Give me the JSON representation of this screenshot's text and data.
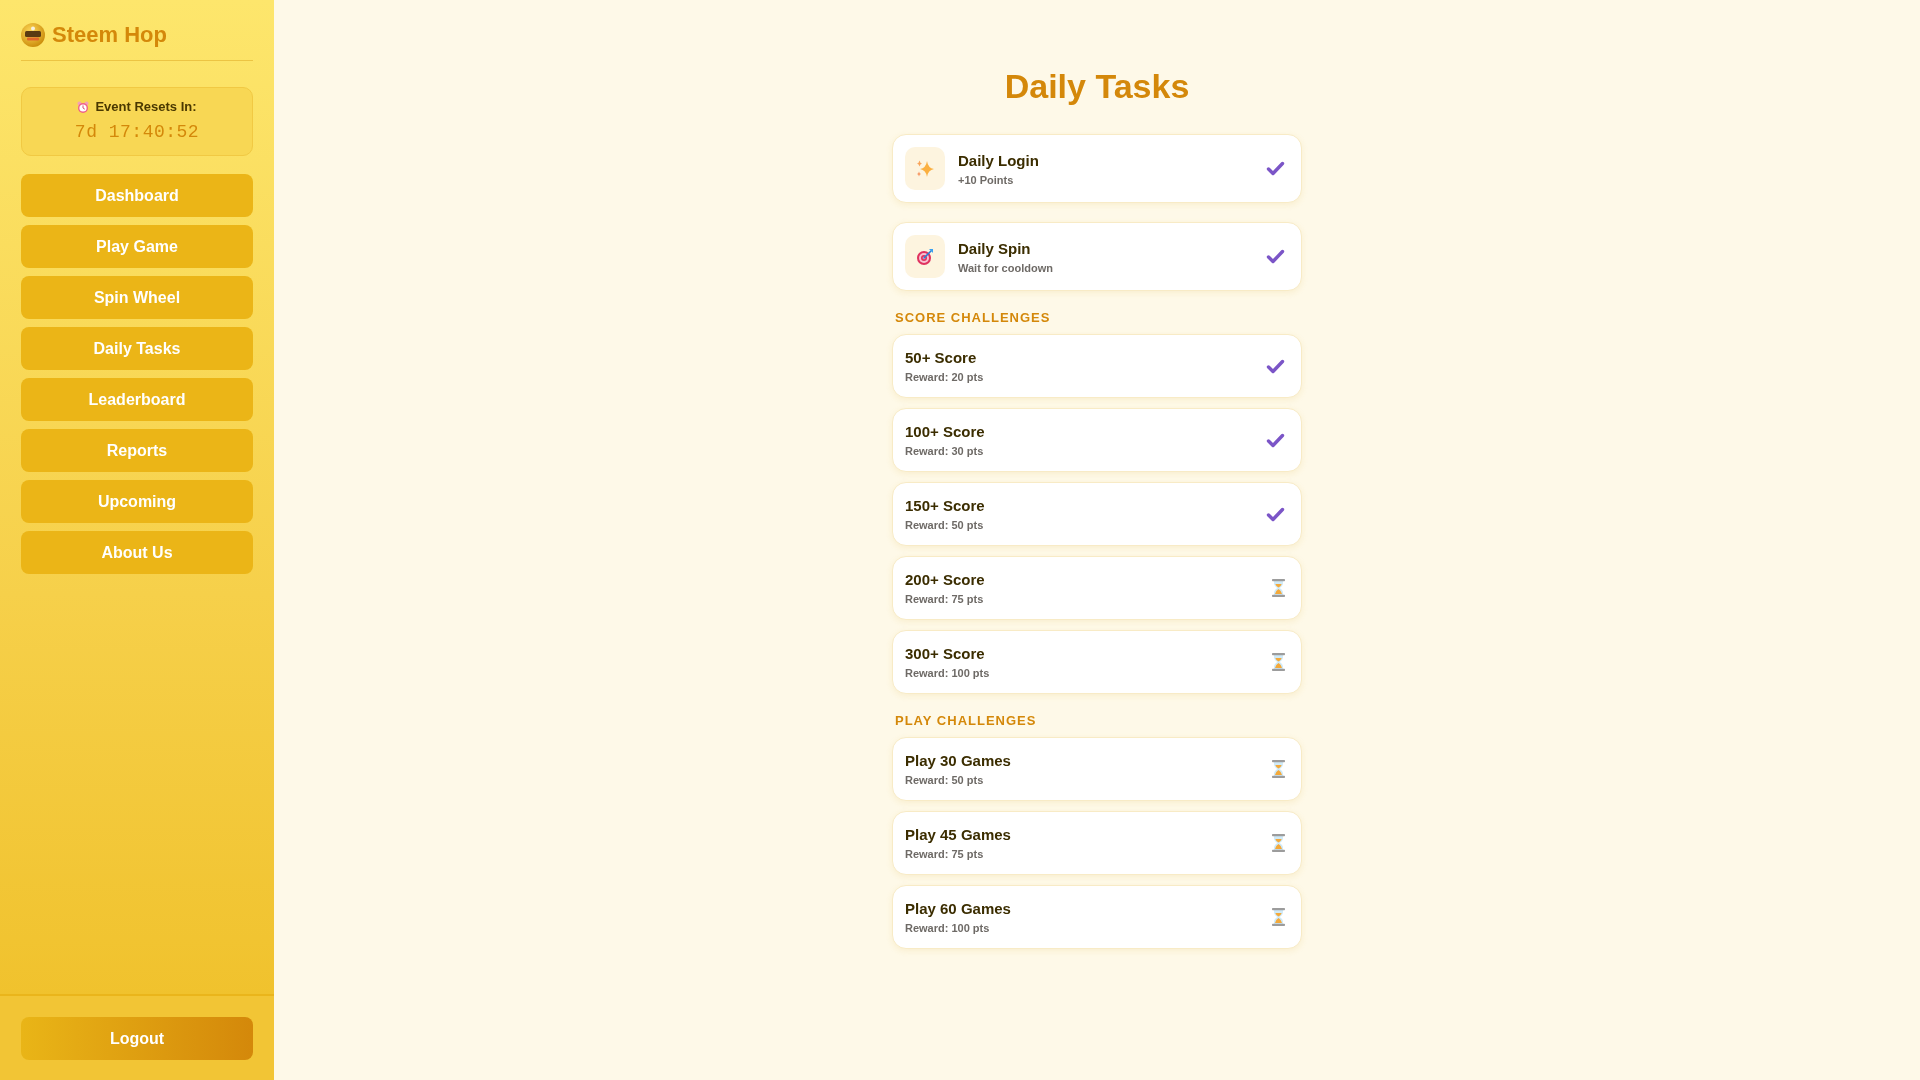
{
  "sidebar": {
    "brand": "Steem Hop",
    "event_timer": {
      "label": "Event Resets In:",
      "value": "7d 17:40:52"
    },
    "nav": [
      "Dashboard",
      "Play Game",
      "Spin Wheel",
      "Daily Tasks",
      "Leaderboard",
      "Reports",
      "Upcoming",
      "About Us"
    ],
    "logout": "Logout"
  },
  "page": {
    "title": "Daily Tasks"
  },
  "daily_tasks": [
    {
      "title": "Daily Login",
      "subtitle": "+10 Points",
      "done": true
    },
    {
      "title": "Daily Spin",
      "subtitle": "Wait for cooldown",
      "done": true
    }
  ],
  "sections": [
    {
      "heading": "SCORE CHALLENGES",
      "challenges": [
        {
          "title": "50+ Score",
          "reward": "Reward: 20 pts",
          "done": true
        },
        {
          "title": "100+ Score",
          "reward": "Reward: 30 pts",
          "done": true
        },
        {
          "title": "150+ Score",
          "reward": "Reward: 50 pts",
          "done": true
        },
        {
          "title": "200+ Score",
          "reward": "Reward: 75 pts",
          "done": false
        },
        {
          "title": "300+ Score",
          "reward": "Reward: 100 pts",
          "done": false
        }
      ]
    },
    {
      "heading": "PLAY CHALLENGES",
      "challenges": [
        {
          "title": "Play 30 Games",
          "reward": "Reward: 50 pts",
          "done": false
        },
        {
          "title": "Play 45 Games",
          "reward": "Reward: 75 pts",
          "done": false
        },
        {
          "title": "Play 60 Games",
          "reward": "Reward: 100 pts",
          "done": false
        }
      ]
    }
  ]
}
